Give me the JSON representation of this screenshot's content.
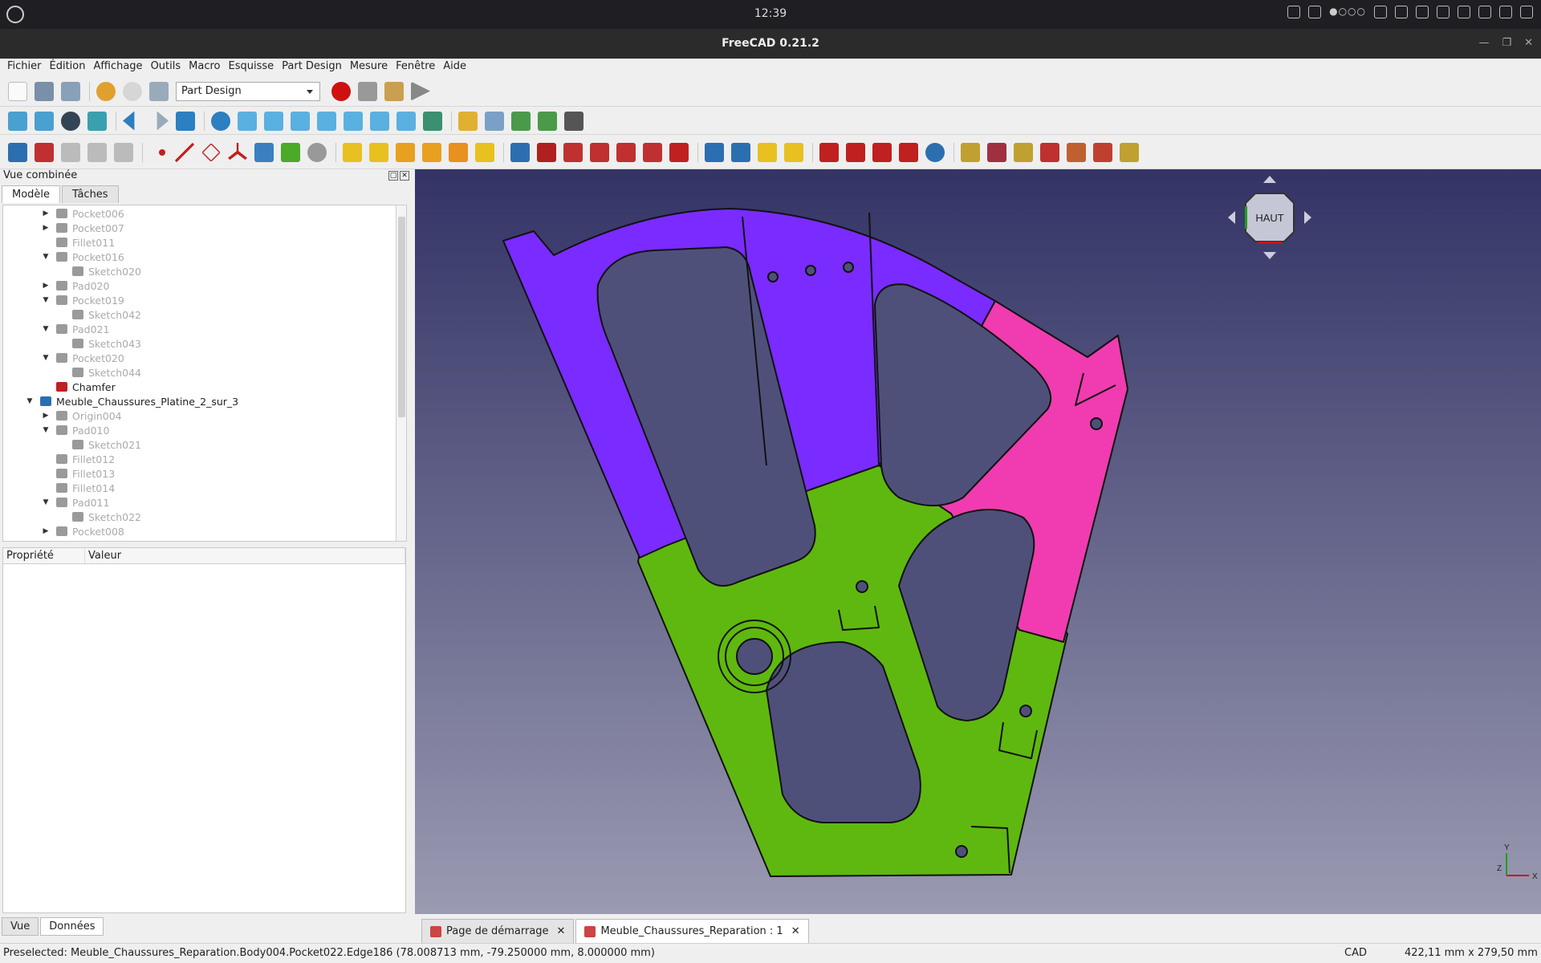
{
  "system": {
    "clock": "12:39"
  },
  "window": {
    "title": "FreeCAD 0.21.2"
  },
  "menu": [
    "Fichier",
    "Édition",
    "Affichage",
    "Outils",
    "Macro",
    "Esquisse",
    "Part Design",
    "Mesure",
    "Fenêtre",
    "Aide"
  ],
  "toolbar": {
    "workbench": "Part Design"
  },
  "panel": {
    "title": "Vue combinée",
    "tab_model": "Modèle",
    "tab_tasks": "Tâches",
    "prop_col": "Propriété",
    "val_col": "Valeur",
    "tab_view": "Vue",
    "tab_data": "Données"
  },
  "tree": [
    {
      "label": "Pocket006",
      "indent": 2,
      "arrow": "right",
      "state": "gray"
    },
    {
      "label": "Pocket007",
      "indent": 2,
      "arrow": "right",
      "state": "gray"
    },
    {
      "label": "Fillet011",
      "indent": 2,
      "arrow": "",
      "state": "gray"
    },
    {
      "label": "Pocket016",
      "indent": 2,
      "arrow": "down",
      "state": "gray"
    },
    {
      "label": "Sketch020",
      "indent": 3,
      "arrow": "",
      "state": "gray"
    },
    {
      "label": "Pad020",
      "indent": 2,
      "arrow": "right",
      "state": "gray"
    },
    {
      "label": "Pocket019",
      "indent": 2,
      "arrow": "down",
      "state": "gray"
    },
    {
      "label": "Sketch042",
      "indent": 3,
      "arrow": "",
      "state": "gray"
    },
    {
      "label": "Pad021",
      "indent": 2,
      "arrow": "down",
      "state": "gray"
    },
    {
      "label": "Sketch043",
      "indent": 3,
      "arrow": "",
      "state": "gray"
    },
    {
      "label": "Pocket020",
      "indent": 2,
      "arrow": "down",
      "state": "gray"
    },
    {
      "label": "Sketch044",
      "indent": 3,
      "arrow": "",
      "state": "gray"
    },
    {
      "label": "Chamfer",
      "indent": 2,
      "arrow": "",
      "state": "active"
    },
    {
      "label": "Meuble_Chaussures_Platine_2_sur_3",
      "indent": 1,
      "arrow": "down",
      "state": "body"
    },
    {
      "label": "Origin004",
      "indent": 2,
      "arrow": "right",
      "state": "gray"
    },
    {
      "label": "Pad010",
      "indent": 2,
      "arrow": "down",
      "state": "gray"
    },
    {
      "label": "Sketch021",
      "indent": 3,
      "arrow": "",
      "state": "gray"
    },
    {
      "label": "Fillet012",
      "indent": 2,
      "arrow": "",
      "state": "gray"
    },
    {
      "label": "Fillet013",
      "indent": 2,
      "arrow": "",
      "state": "gray"
    },
    {
      "label": "Fillet014",
      "indent": 2,
      "arrow": "",
      "state": "gray"
    },
    {
      "label": "Pad011",
      "indent": 2,
      "arrow": "down",
      "state": "gray"
    },
    {
      "label": "Sketch022",
      "indent": 3,
      "arrow": "",
      "state": "gray"
    },
    {
      "label": "Pocket008",
      "indent": 2,
      "arrow": "right",
      "state": "gray"
    }
  ],
  "navcube": {
    "face": "HAUT"
  },
  "axes": {
    "x": "X",
    "y": "Y",
    "z": "Z"
  },
  "doctabs": [
    {
      "label": "Page de démarrage",
      "active": false
    },
    {
      "label": "Meuble_Chaussures_Reparation : 1",
      "active": true
    }
  ],
  "status": {
    "message": "Preselected: Meuble_Chaussures_Reparation.Body004.Pocket022.Edge186 (78.008713 mm, -79.250000 mm, 8.000000 mm)",
    "nav": "CAD",
    "dimensions": "422,11 mm x 279,50 mm"
  },
  "colors": {
    "purple": "#7a2bff",
    "pink": "#f03cb0",
    "green": "#5fb80f"
  }
}
